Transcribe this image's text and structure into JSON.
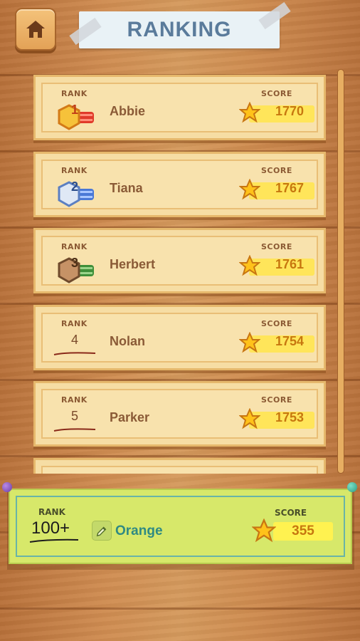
{
  "header": {
    "title": "RANKING",
    "home_icon": "home-icon"
  },
  "labels": {
    "rank": "RANK",
    "score": "SCORE"
  },
  "colors": {
    "gold_badge": "#e03a2a",
    "silver_badge": "#4a78d6",
    "bronze_badge": "#6f4a2c",
    "score_text": "#c7770f",
    "my_name": "#2f8a83"
  },
  "leaderboard": [
    {
      "rank": "1",
      "name": "Abbie",
      "score": "1770",
      "badge": "rank-1-badge"
    },
    {
      "rank": "2",
      "name": "Tiana",
      "score": "1767",
      "badge": "rank-2-badge"
    },
    {
      "rank": "3",
      "name": "Herbert",
      "score": "1761",
      "badge": "rank-3-badge"
    },
    {
      "rank": "4",
      "name": "Nolan",
      "score": "1754"
    },
    {
      "rank": "5",
      "name": "Parker",
      "score": "1753"
    },
    {
      "rank": "",
      "name": "",
      "score": ""
    }
  ],
  "my_entry": {
    "rank_label": "RANK",
    "rank": "100+",
    "name": "Orange",
    "score_label": "SCORE",
    "score": "355",
    "edit_icon": "pencil-icon"
  }
}
